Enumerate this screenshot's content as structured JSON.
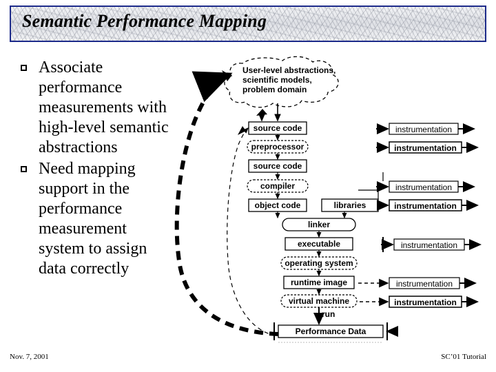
{
  "slide": {
    "title": "Semantic Performance Mapping",
    "bullets": [
      "Associate performance measurements with high-level semantic abstractions",
      "Need mapping support in the performance measurement system to assign data correctly"
    ],
    "footer_left": "Nov. 7, 2001",
    "footer_right": "SC’01 Tutorial",
    "title_border_color": "#1c2a8a"
  },
  "diagram": {
    "cloud": {
      "line1": "User-level abstractions,",
      "line2": "scientific models,",
      "line3": "problem domain"
    },
    "pipeline": [
      {
        "label": "source code",
        "shape": "box"
      },
      {
        "label": "preprocessor",
        "shape": "rounded"
      },
      {
        "label": "source code",
        "shape": "box"
      },
      {
        "label": "compiler",
        "shape": "rounded"
      },
      {
        "label": "object code",
        "shape": "box"
      },
      {
        "label": "linker",
        "shape": "rounded"
      },
      {
        "label": "executable",
        "shape": "box"
      },
      {
        "label": "operating system",
        "shape": "rounded"
      },
      {
        "label": "runtime image",
        "shape": "box"
      },
      {
        "label": "virtual machine",
        "shape": "rounded"
      }
    ],
    "libraries_label": "libraries",
    "run_label": "run",
    "performance_data_label": "Performance Data",
    "instrumentation_label": "instrumentation",
    "instrumentation_count": 7
  }
}
